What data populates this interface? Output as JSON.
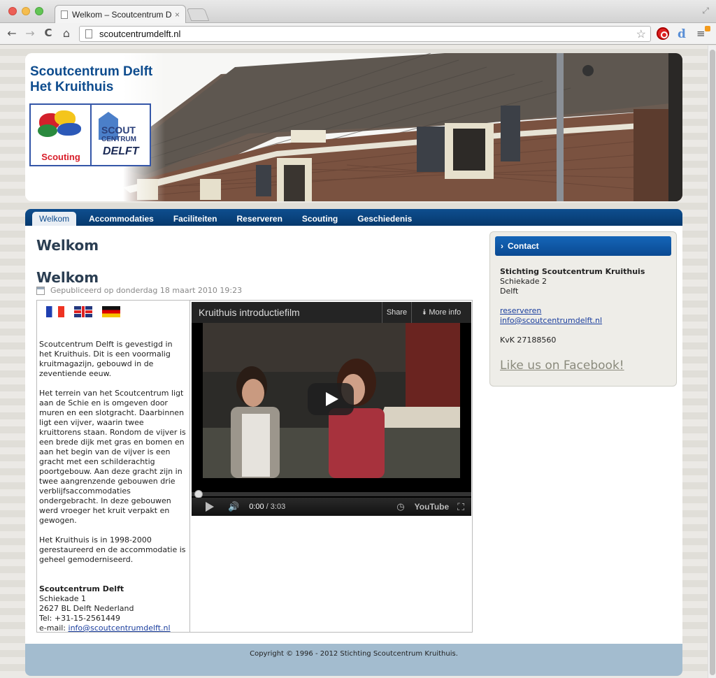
{
  "browser": {
    "tab_title": "Welkom – Scoutcentrum Delf",
    "tab_close": "×",
    "url": "scoutcentrumdelft.nl",
    "back_icon": "←",
    "forward_icon": "→",
    "reload_icon": "C",
    "home_icon": "⌂",
    "star_icon": "☆",
    "ext_d": "d",
    "menu_icon": "≡"
  },
  "header": {
    "title_line1": "Scoutcentrum Delft",
    "title_line2": "Het Kruithuis",
    "logo_scouting": "Scouting",
    "logo_centrum_1": "SCOUT",
    "logo_centrum_2": "CENTRUM",
    "logo_centrum_3": "DELFT"
  },
  "nav": {
    "items": [
      "Welkom",
      "Accommodaties",
      "Faciliteiten",
      "Reserveren",
      "Scouting",
      "Geschiedenis"
    ],
    "active": "Welkom"
  },
  "main": {
    "page_title": "Welkom",
    "article_title": "Welkom",
    "published": "Gepubliceerd op donderdag 18 maart 2010 19:23",
    "para1": "Scoutcentrum Delft is gevestigd in het Kruithuis. Dit is een voormalig kruitmagazijn, gebouwd in de zeventiende eeuw.",
    "para2": "Het terrein van het Scoutcentrum ligt aan de Schie en is omgeven door muren en een slotgracht. Daarbinnen ligt een vijver, waarin twee kruittorens staan. Rondom de vijver is een brede dijk met gras en bomen en aan het begin van de vijver is een gracht met een schilderachtig poortgebouw. Aan deze gracht zijn in twee aangrenzende gebouwen drie verblijfsaccommodaties ondergebracht. In deze gebouwen werd vroeger het kruit verpakt en gewogen.",
    "para3": "Het Kruithuis is in 1998-2000 gerestaureerd en de accommodatie is geheel gemoderniseerd.",
    "addr_name": "Scoutcentrum Delft",
    "addr_street": "Schiekade 1",
    "addr_city": "2627 BL Delft Nederland",
    "addr_tel": "Tel: +31-15-2561449",
    "addr_email_label": "e-mail: ",
    "addr_email": "info@scoutcentrumdelft.nl"
  },
  "video": {
    "title": "Kruithuis introductiefilm",
    "share": "Share",
    "more_info": "More info",
    "time_current": "0:00",
    "time_total": " / 3:03",
    "youtube": "YouTube",
    "progress": 0
  },
  "sidebar": {
    "heading": "Contact",
    "org": "Stichting Scoutcentrum Kruithuis",
    "street": "Schiekade 2",
    "city": "Delft",
    "link_reserve": "reserveren",
    "link_email": "info@scoutcentrumdelft.nl",
    "kvk": "KvK 27188560",
    "facebook": "Like us on Facebook!"
  },
  "footer": {
    "copyright": "Copyright © 1996 - 2012 Stichting Scoutcentrum Kruithuis."
  }
}
